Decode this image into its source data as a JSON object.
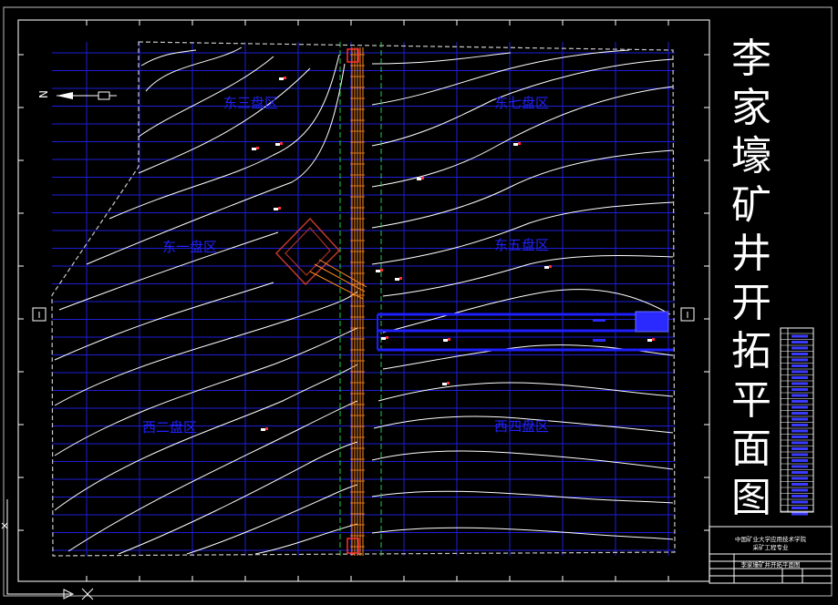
{
  "drawing": {
    "title_chars": [
      "李",
      "家",
      "壕",
      "矿",
      "井",
      "开",
      "拓",
      "平",
      "面",
      "图"
    ],
    "zones": {
      "east_three": "东三盘区",
      "east_seven": "东七盘区",
      "east_one": "东一盘区",
      "east_five": "东五盘区",
      "west_two": "西二盘区",
      "west_four": "西四盘区"
    },
    "section_mark": "I",
    "north_arrow": "N",
    "title_block": {
      "line1": "中国矿业大学应用技术学院",
      "line2": "采矿工程专业",
      "line3": "李家壕矿井开拓平面图"
    },
    "colors": {
      "background": "#000000",
      "grid": "#1e1ed8",
      "contour": "#ffffff",
      "boundary": "#c8c8c8",
      "zone_label": "#2222ff",
      "roadway": "#ff8a1e",
      "protective_pillar": "#22cc44",
      "main_roadway_blue": "#1e1eff"
    }
  }
}
